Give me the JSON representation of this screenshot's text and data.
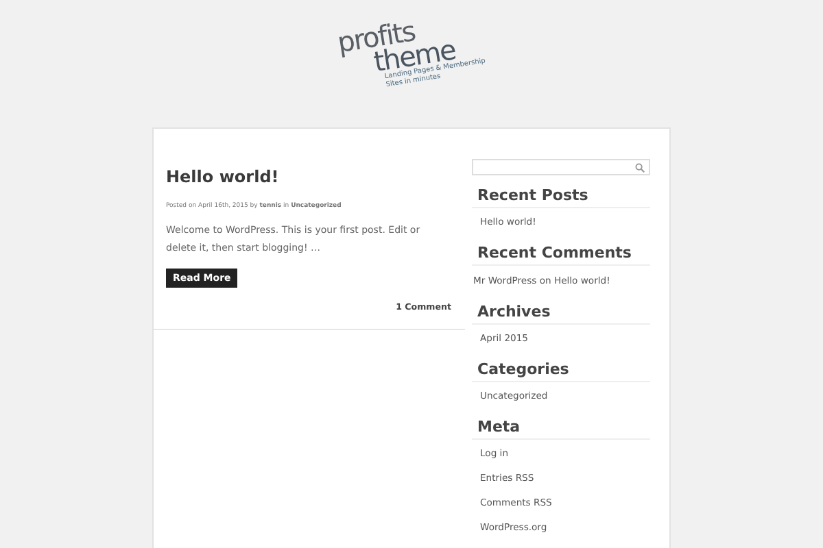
{
  "logo": {
    "line_1": "profits",
    "line_2": "theme",
    "tagline_1": "Landing Pages & Membership",
    "tagline_2": "Sites in minutes"
  },
  "post": {
    "title": "Hello world!",
    "meta": "Posted on April 16th, 2015 by **tennis** in **Uncategorized**",
    "excerpt": "Welcome to WordPress. This is your first post. Edit or delete it, then start blogging! …",
    "button": "Read More",
    "comments": "1 Comment"
  },
  "sidebar": {
    "widgets": [
      {
        "title": "Recent Posts",
        "kind": "list",
        "items": [
          "Hello world!"
        ]
      },
      {
        "title": "Recent Comments",
        "kind": "comments",
        "items": [
          "Mr WordPress on Hello world!"
        ]
      },
      {
        "title": "Archives",
        "kind": "list",
        "items": [
          "April 2015"
        ]
      },
      {
        "title": "Categories",
        "kind": "list",
        "items": [
          "Uncategorized"
        ]
      },
      {
        "title": "Meta",
        "kind": "list",
        "items": [
          "Log in",
          "Entries RSS",
          "Comments RSS",
          "WordPress.org"
        ]
      }
    ]
  }
}
